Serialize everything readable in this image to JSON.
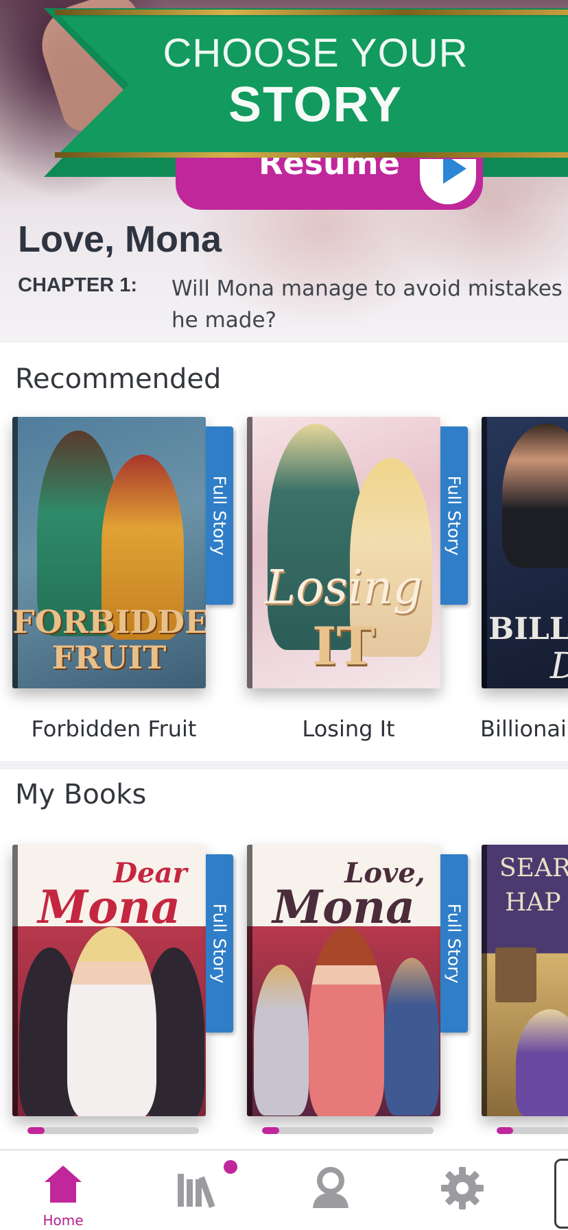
{
  "banner": {
    "line1": "CHOOSE YOUR",
    "line2": "STORY",
    "green": "#139a5e",
    "gold": "#d8b24a"
  },
  "current_story": {
    "resume_label": "Resume",
    "title": "Love, Mona",
    "chapter_label": "CHAPTER 1:",
    "chapter_description": "Will Mona manage to avoid mistakes he made?"
  },
  "recommended": {
    "heading": "Recommended",
    "books": [
      {
        "name": "Forbidden Fruit",
        "badge": "Full Story",
        "cover_line1": "FORBIDDEN",
        "cover_line2": "FRUIT"
      },
      {
        "name": "Losing It",
        "badge": "Full Story",
        "cover_line1": "Losing",
        "cover_line2": "IT"
      },
      {
        "name": "Billionair",
        "cover_line1": "BILLIO",
        "cover_line2": "D"
      }
    ]
  },
  "my_books": {
    "heading": "My Books",
    "books": [
      {
        "badge": "Full Story",
        "cover_line1": "Dear",
        "cover_line2": "Mona",
        "progress": 0.1
      },
      {
        "badge": "Full Story",
        "cover_line1": "Love,",
        "cover_line2": "Mona",
        "progress": 0.1
      },
      {
        "cover_line1": "SEAR",
        "cover_line2": "HAP",
        "progress": 0.1
      }
    ]
  },
  "nav": {
    "items": [
      {
        "label": "Home",
        "icon": "home-icon",
        "active": true
      },
      {
        "label": "",
        "icon": "library-icon",
        "notification": true
      },
      {
        "label": "",
        "icon": "profile-icon"
      },
      {
        "label": "",
        "icon": "gear-icon"
      }
    ],
    "accent": "#c0279a"
  }
}
